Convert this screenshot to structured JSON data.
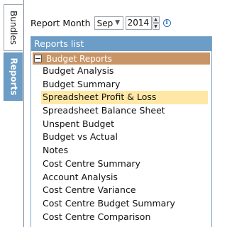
{
  "side_tabs": [
    {
      "label": "Bundles",
      "active": false
    },
    {
      "label": "Reports",
      "active": true
    }
  ],
  "month_picker": {
    "label": "Report Month",
    "month": "Sep",
    "year": "2014"
  },
  "reports_panel": {
    "title": "Reports list",
    "group": {
      "label": "Budget Reports",
      "expanded": true
    },
    "items": [
      "Budget Analysis",
      "Budget Summary",
      "Spreadsheet Profit & Loss",
      "Spreadsheet Balance Sheet",
      "Unspent Budget",
      "Budget vs Actual",
      "Notes",
      "Cost Centre Summary",
      "Account Analysis",
      "Cost Centre Variance",
      "Cost Centre Budget Summary",
      "Cost Centre Comparison"
    ],
    "selected_index": 2
  },
  "colors": {
    "tab_active": "#6c9dc6",
    "group_header": "#c99566",
    "selection": "#ffe8a6"
  }
}
